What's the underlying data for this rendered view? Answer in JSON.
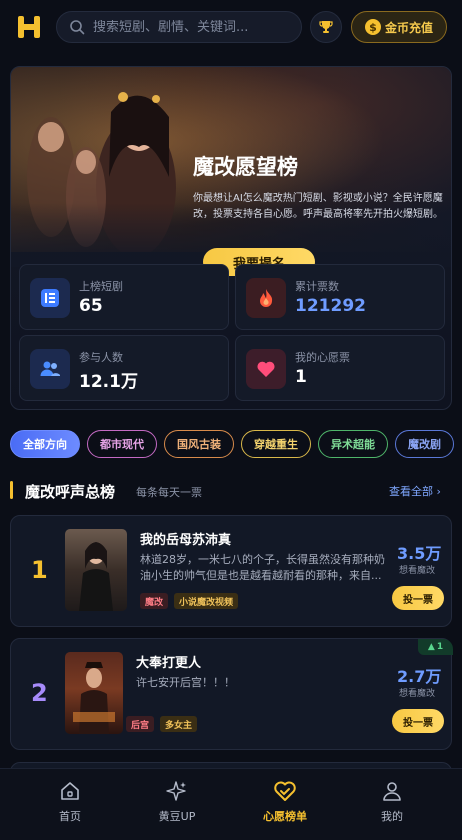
{
  "header": {
    "search_placeholder": "搜索短剧、剧情、关键词...",
    "recharge_label": "金币充值",
    "coin_symbol": "$"
  },
  "hero": {
    "title": "魔改愿望榜",
    "description": "你最想让AI怎么魔改热门短剧、影视或小说？全民许愿魔改，投票支持各自心愿。呼声最高将率先开拍火爆短剧。",
    "button": "我要提名"
  },
  "stats": [
    {
      "label": "上榜短剧",
      "value": "65",
      "icon": "list-icon"
    },
    {
      "label": "累计票数",
      "value": "121292",
      "icon": "flame-icon"
    },
    {
      "label": "参与人数",
      "value": "12.1万",
      "icon": "users-icon"
    },
    {
      "label": "我的心愿票",
      "value": "1",
      "icon": "heart-icon"
    }
  ],
  "filters": [
    "全部方向",
    "都市现代",
    "国风古装",
    "穿越重生",
    "异术超能",
    "魔改剧"
  ],
  "section": {
    "title": "魔改呼声总榜",
    "subtitle": "每条每天一票",
    "more": "查看全部 ›"
  },
  "ranks": [
    {
      "rank": "1",
      "title": "我的岳母苏沛真",
      "desc": "林道28岁，一米七八的个子，长得虽然没有那种奶油小生的帅气但是也是越看越耐看的那种，来自...",
      "tags": [
        "魔改",
        "小说魔改视频"
      ],
      "count": "3.5万",
      "count_label": "想看魔改",
      "vote": "投一票"
    },
    {
      "rank": "2",
      "title": "大奉打更人",
      "desc": "许七安开后宫！！！",
      "tags": [
        "后宫",
        "多女主"
      ],
      "count": "2.7万",
      "count_label": "想看魔改",
      "vote": "投一票",
      "badge": "1"
    }
  ],
  "nav": [
    {
      "label": "首页",
      "icon": "home-icon"
    },
    {
      "label": "黄豆UP",
      "icon": "sparkle-icon"
    },
    {
      "label": "心愿榜单",
      "icon": "heart-list-icon"
    },
    {
      "label": "我的",
      "icon": "user-icon"
    }
  ],
  "colors": {
    "accent": "#f5c02f",
    "count_blue": "#6f9cff",
    "background": "#0b0e17"
  }
}
